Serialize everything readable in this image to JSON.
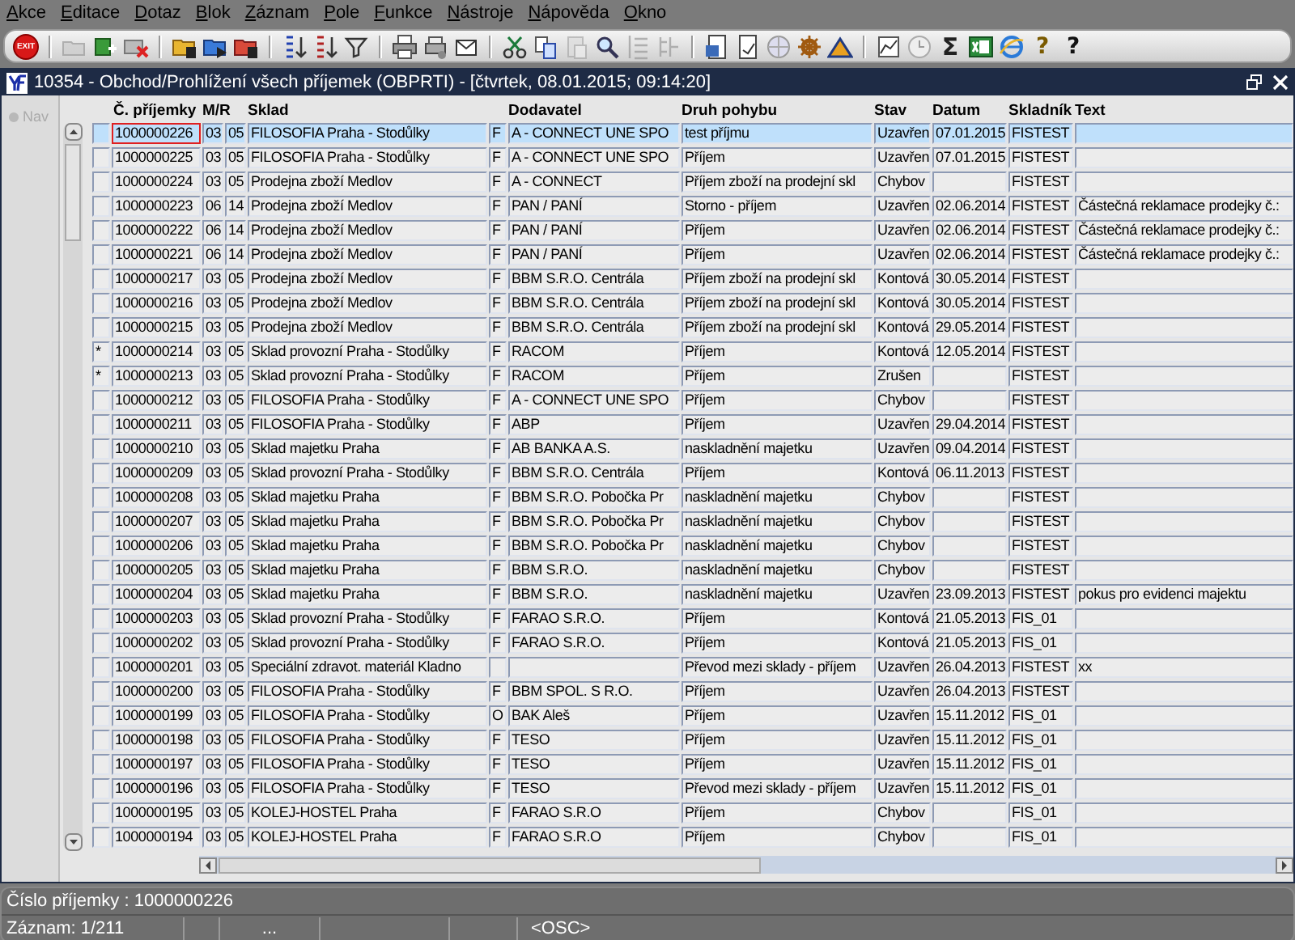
{
  "menu": [
    {
      "label": "Akce"
    },
    {
      "label": "Editace"
    },
    {
      "label": "Dotaz"
    },
    {
      "label": "Blok"
    },
    {
      "label": "Záznam"
    },
    {
      "label": "Pole"
    },
    {
      "label": "Funkce"
    },
    {
      "label": "Nástroje"
    },
    {
      "label": "Nápověda"
    },
    {
      "label": "Okno"
    }
  ],
  "toolbar": {
    "exit_label": "EXIT",
    "sum_label": "Σ",
    "help_label": "?",
    "help2_label": "?"
  },
  "window": {
    "title": "10354 - Obchod/Prohlížení všech příjemek (OBPRTI) - [čtvrtek, 08.01.2015; 09:14:20]"
  },
  "nav": {
    "label": "Nav"
  },
  "table": {
    "columns": [
      "Č. příjemky",
      "M/R",
      "Sklad",
      "Dodavatel",
      "Druh pohybu",
      "Stav",
      "Datum",
      "Skladník",
      "Text"
    ],
    "rows": [
      {
        "selected": true,
        "marker": "",
        "number": "1000000226",
        "m": "03",
        "r": "05",
        "sklad": "FILOSOFIA Praha - Stodůlky",
        "f": "F",
        "dodavatel": "A - CONNECT UNE SPO",
        "druh": "test příjmu",
        "stav": "Uzavřen",
        "datum": "07.01.2015",
        "skladnik": "FISTEST",
        "text": ""
      },
      {
        "selected": false,
        "marker": "",
        "number": "1000000225",
        "m": "03",
        "r": "05",
        "sklad": "FILOSOFIA Praha - Stodůlky",
        "f": "F",
        "dodavatel": "A - CONNECT UNE SPO",
        "druh": "Příjem",
        "stav": "Uzavřen",
        "datum": "07.01.2015",
        "skladnik": "FISTEST",
        "text": ""
      },
      {
        "selected": false,
        "marker": "",
        "number": "1000000224",
        "m": "03",
        "r": "05",
        "sklad": "Prodejna zboží Medlov",
        "f": "F",
        "dodavatel": "A - CONNECT",
        "druh": "Příjem zboží na prodejní skl",
        "stav": "Chybov",
        "datum": "",
        "skladnik": "FISTEST",
        "text": ""
      },
      {
        "selected": false,
        "marker": "",
        "number": "1000000223",
        "m": "06",
        "r": "14",
        "sklad": "Prodejna zboží Medlov",
        "f": "F",
        "dodavatel": "PAN / PANÍ",
        "druh": "Storno - příjem",
        "stav": "Uzavřen",
        "datum": "02.06.2014",
        "skladnik": "FISTEST",
        "text": "Částečná reklamace prodejky č.:"
      },
      {
        "selected": false,
        "marker": "",
        "number": "1000000222",
        "m": "06",
        "r": "14",
        "sklad": "Prodejna zboží Medlov",
        "f": "F",
        "dodavatel": "PAN / PANÍ",
        "druh": "Příjem",
        "stav": "Uzavřen",
        "datum": "02.06.2014",
        "skladnik": "FISTEST",
        "text": "Částečná reklamace prodejky č.:"
      },
      {
        "selected": false,
        "marker": "",
        "number": "1000000221",
        "m": "06",
        "r": "14",
        "sklad": "Prodejna zboží Medlov",
        "f": "F",
        "dodavatel": "PAN / PANÍ",
        "druh": "Příjem",
        "stav": "Uzavřen",
        "datum": "02.06.2014",
        "skladnik": "FISTEST",
        "text": "Částečná reklamace prodejky č.:"
      },
      {
        "selected": false,
        "marker": "",
        "number": "1000000217",
        "m": "03",
        "r": "05",
        "sklad": "Prodejna zboží Medlov",
        "f": "F",
        "dodavatel": "BBM S.R.O. Centrála",
        "druh": "Příjem zboží na prodejní skl",
        "stav": "Kontová",
        "datum": "30.05.2014",
        "skladnik": "FISTEST",
        "text": ""
      },
      {
        "selected": false,
        "marker": "",
        "number": "1000000216",
        "m": "03",
        "r": "05",
        "sklad": "Prodejna zboží Medlov",
        "f": "F",
        "dodavatel": "BBM S.R.O. Centrála",
        "druh": "Příjem zboží na prodejní skl",
        "stav": "Kontová",
        "datum": "30.05.2014",
        "skladnik": "FISTEST",
        "text": ""
      },
      {
        "selected": false,
        "marker": "",
        "number": "1000000215",
        "m": "03",
        "r": "05",
        "sklad": "Prodejna zboží Medlov",
        "f": "F",
        "dodavatel": "BBM S.R.O. Centrála",
        "druh": "Příjem zboží na prodejní skl",
        "stav": "Kontová",
        "datum": "29.05.2014",
        "skladnik": "FISTEST",
        "text": ""
      },
      {
        "selected": false,
        "marker": "*",
        "number": "1000000214",
        "m": "03",
        "r": "05",
        "sklad": "Sklad provozní Praha - Stodůlky",
        "f": "F",
        "dodavatel": "RACOM",
        "druh": "Příjem",
        "stav": "Kontová",
        "datum": "12.05.2014",
        "skladnik": "FISTEST",
        "text": ""
      },
      {
        "selected": false,
        "marker": "*",
        "number": "1000000213",
        "m": "03",
        "r": "05",
        "sklad": "Sklad provozní Praha - Stodůlky",
        "f": "F",
        "dodavatel": "RACOM",
        "druh": "Příjem",
        "stav": "Zrušen",
        "datum": "",
        "skladnik": "FISTEST",
        "text": ""
      },
      {
        "selected": false,
        "marker": "",
        "number": "1000000212",
        "m": "03",
        "r": "05",
        "sklad": "FILOSOFIA Praha - Stodůlky",
        "f": "F",
        "dodavatel": "A - CONNECT UNE SPO",
        "druh": "Příjem",
        "stav": "Chybov",
        "datum": "",
        "skladnik": "FISTEST",
        "text": ""
      },
      {
        "selected": false,
        "marker": "",
        "number": "1000000211",
        "m": "03",
        "r": "05",
        "sklad": "FILOSOFIA Praha - Stodůlky",
        "f": "F",
        "dodavatel": "ABP",
        "druh": "Příjem",
        "stav": "Uzavřen",
        "datum": "29.04.2014",
        "skladnik": "FISTEST",
        "text": ""
      },
      {
        "selected": false,
        "marker": "",
        "number": "1000000210",
        "m": "03",
        "r": "05",
        "sklad": "Sklad majetku Praha",
        "f": "F",
        "dodavatel": "AB BANKA A.S.",
        "druh": "naskladnění majetku",
        "stav": "Uzavřen",
        "datum": "09.04.2014",
        "skladnik": "FISTEST",
        "text": ""
      },
      {
        "selected": false,
        "marker": "",
        "number": "1000000209",
        "m": "03",
        "r": "05",
        "sklad": "Sklad provozní Praha - Stodůlky",
        "f": "F",
        "dodavatel": "BBM S.R.O. Centrála",
        "druh": "Příjem",
        "stav": "Kontová",
        "datum": "06.11.2013",
        "skladnik": "FISTEST",
        "text": ""
      },
      {
        "selected": false,
        "marker": "",
        "number": "1000000208",
        "m": "03",
        "r": "05",
        "sklad": "Sklad majetku Praha",
        "f": "F",
        "dodavatel": "BBM S.R.O. Pobočka Pr",
        "druh": "naskladnění majetku",
        "stav": "Chybov",
        "datum": "",
        "skladnik": "FISTEST",
        "text": ""
      },
      {
        "selected": false,
        "marker": "",
        "number": "1000000207",
        "m": "03",
        "r": "05",
        "sklad": "Sklad majetku Praha",
        "f": "F",
        "dodavatel": "BBM S.R.O. Pobočka Pr",
        "druh": "naskladnění majetku",
        "stav": "Chybov",
        "datum": "",
        "skladnik": "FISTEST",
        "text": ""
      },
      {
        "selected": false,
        "marker": "",
        "number": "1000000206",
        "m": "03",
        "r": "05",
        "sklad": "Sklad majetku Praha",
        "f": "F",
        "dodavatel": "BBM S.R.O. Pobočka Pr",
        "druh": "naskladnění majetku",
        "stav": "Chybov",
        "datum": "",
        "skladnik": "FISTEST",
        "text": ""
      },
      {
        "selected": false,
        "marker": "",
        "number": "1000000205",
        "m": "03",
        "r": "05",
        "sklad": "Sklad majetku Praha",
        "f": "F",
        "dodavatel": "BBM S.R.O.",
        "druh": "naskladnění majetku",
        "stav": "Chybov",
        "datum": "",
        "skladnik": "FISTEST",
        "text": ""
      },
      {
        "selected": false,
        "marker": "",
        "number": "1000000204",
        "m": "03",
        "r": "05",
        "sklad": "Sklad majetku Praha",
        "f": "F",
        "dodavatel": "BBM S.R.O.",
        "druh": "naskladnění majetku",
        "stav": "Uzavřen",
        "datum": "23.09.2013",
        "skladnik": "FISTEST",
        "text": "pokus pro evidenci majektu"
      },
      {
        "selected": false,
        "marker": "",
        "number": "1000000203",
        "m": "03",
        "r": "05",
        "sklad": "Sklad provozní Praha - Stodůlky",
        "f": "F",
        "dodavatel": "FARAO S.R.O.",
        "druh": "Příjem",
        "stav": "Kontová",
        "datum": "21.05.2013",
        "skladnik": "FIS_01",
        "text": ""
      },
      {
        "selected": false,
        "marker": "",
        "number": "1000000202",
        "m": "03",
        "r": "05",
        "sklad": "Sklad provozní Praha - Stodůlky",
        "f": "F",
        "dodavatel": "FARAO S.R.O.",
        "druh": "Příjem",
        "stav": "Kontová",
        "datum": "21.05.2013",
        "skladnik": "FIS_01",
        "text": ""
      },
      {
        "selected": false,
        "marker": "",
        "number": "1000000201",
        "m": "03",
        "r": "05",
        "sklad": "Speciální zdravot. materiál Kladno",
        "f": "",
        "dodavatel": "",
        "druh": "Převod mezi sklady - příjem",
        "stav": "Uzavřen",
        "datum": "26.04.2013",
        "skladnik": "FISTEST",
        "text": "xx"
      },
      {
        "selected": false,
        "marker": "",
        "number": "1000000200",
        "m": "03",
        "r": "05",
        "sklad": "FILOSOFIA Praha - Stodůlky",
        "f": "F",
        "dodavatel": "BBM SPOL. S R.O.",
        "druh": "Příjem",
        "stav": "Uzavřen",
        "datum": "26.04.2013",
        "skladnik": "FISTEST",
        "text": ""
      },
      {
        "selected": false,
        "marker": "",
        "number": "1000000199",
        "m": "03",
        "r": "05",
        "sklad": "FILOSOFIA Praha - Stodůlky",
        "f": "O",
        "dodavatel": "BAK Aleš",
        "druh": "Příjem",
        "stav": "Uzavřen",
        "datum": "15.11.2012",
        "skladnik": "FIS_01",
        "text": ""
      },
      {
        "selected": false,
        "marker": "",
        "number": "1000000198",
        "m": "03",
        "r": "05",
        "sklad": "FILOSOFIA Praha - Stodůlky",
        "f": "F",
        "dodavatel": "TESO",
        "druh": "Příjem",
        "stav": "Uzavřen",
        "datum": "15.11.2012",
        "skladnik": "FIS_01",
        "text": ""
      },
      {
        "selected": false,
        "marker": "",
        "number": "1000000197",
        "m": "03",
        "r": "05",
        "sklad": "FILOSOFIA Praha - Stodůlky",
        "f": "F",
        "dodavatel": "TESO",
        "druh": "Příjem",
        "stav": "Uzavřen",
        "datum": "15.11.2012",
        "skladnik": "FIS_01",
        "text": ""
      },
      {
        "selected": false,
        "marker": "",
        "number": "1000000196",
        "m": "03",
        "r": "05",
        "sklad": "FILOSOFIA Praha - Stodůlky",
        "f": "F",
        "dodavatel": "TESO",
        "druh": "Převod mezi sklady - příjem",
        "stav": "Uzavřen",
        "datum": "15.11.2012",
        "skladnik": "FIS_01",
        "text": ""
      },
      {
        "selected": false,
        "marker": "",
        "number": "1000000195",
        "m": "03",
        "r": "05",
        "sklad": "KOLEJ-HOSTEL Praha",
        "f": "F",
        "dodavatel": "FARAO S.R.O",
        "druh": "Příjem",
        "stav": "Chybov",
        "datum": "",
        "skladnik": "FIS_01",
        "text": ""
      },
      {
        "selected": false,
        "marker": "",
        "number": "1000000194",
        "m": "03",
        "r": "05",
        "sklad": "KOLEJ-HOSTEL Praha",
        "f": "F",
        "dodavatel": "FARAO S.R.O",
        "druh": "Příjem",
        "stav": "Chybov",
        "datum": "",
        "skladnik": "FIS_01",
        "text": ""
      }
    ]
  },
  "status_bar": {
    "message": "Číslo příjemky : 1000000226",
    "record": "Záznam: 1/211",
    "ellipsis": "...",
    "mode": "<OSC>"
  }
}
